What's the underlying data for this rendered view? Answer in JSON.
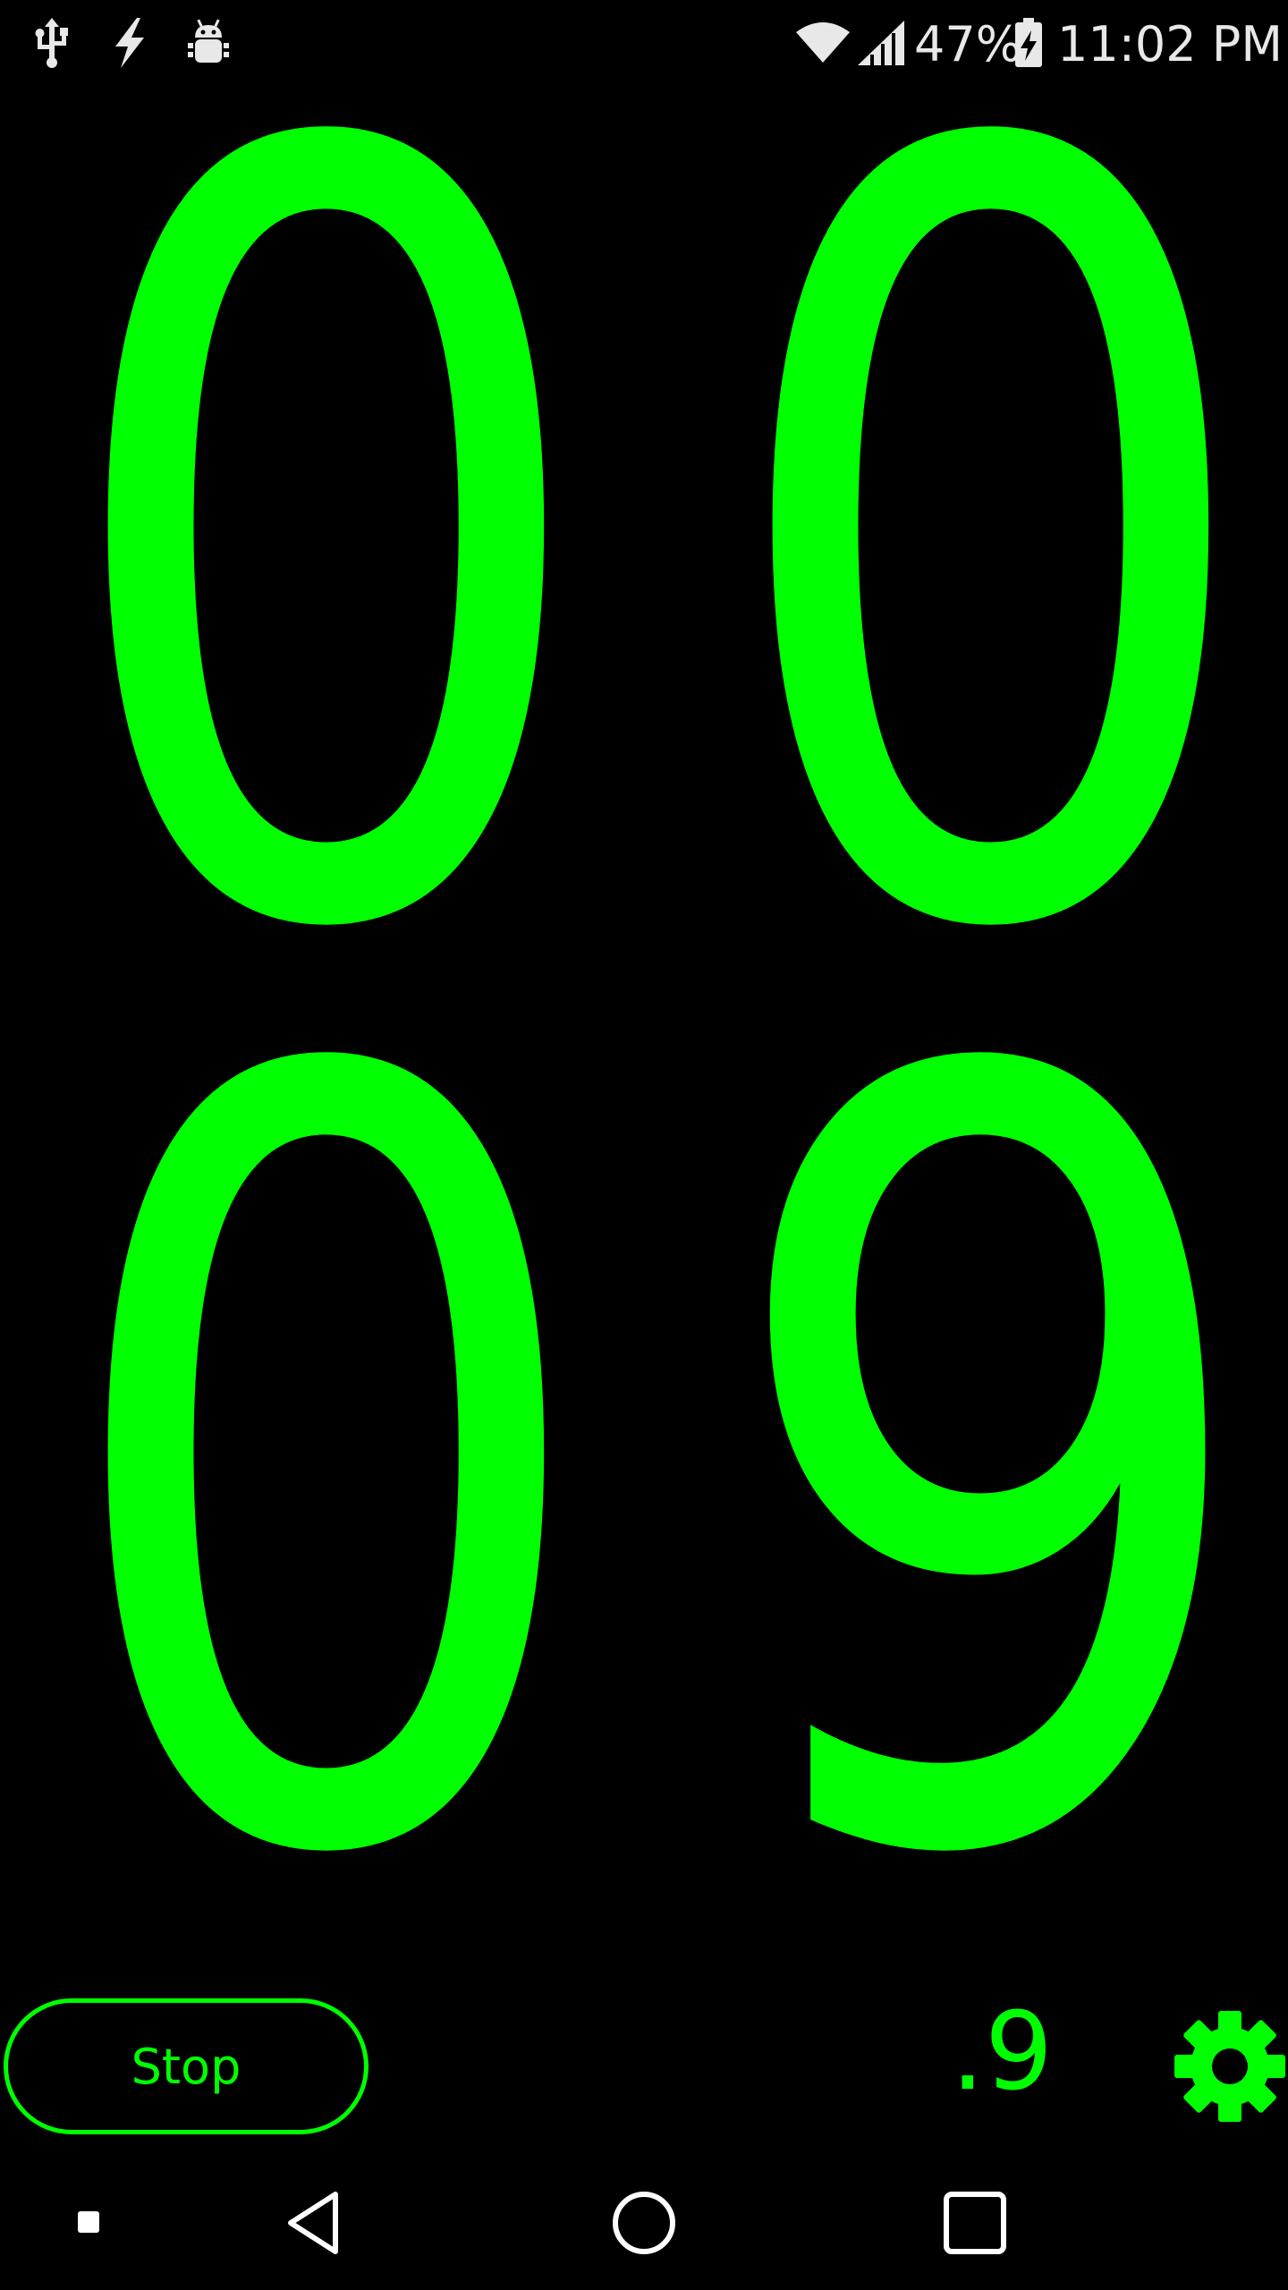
{
  "status_bar": {
    "icons_left": [
      "usb-icon",
      "flash-icon",
      "android-debug-icon"
    ],
    "icons_right": [
      "wifi-icon",
      "signal-icon",
      "battery-charging-icon"
    ],
    "battery_percent": "47%",
    "time": "11:02 PM"
  },
  "timer": {
    "minutes_tens": "0",
    "minutes_ones": "0",
    "seconds_tens": "0",
    "seconds_ones": "9",
    "tenths": ".9"
  },
  "controls": {
    "stop_label": "Stop",
    "settings_icon": "gear-icon"
  },
  "nav_bar": {
    "buttons": [
      "recents-small-icon",
      "back-icon",
      "home-icon",
      "overview-icon"
    ]
  },
  "colors": {
    "accent": "#00ff00",
    "background": "#000000",
    "status_text": "#e8e8e8"
  }
}
